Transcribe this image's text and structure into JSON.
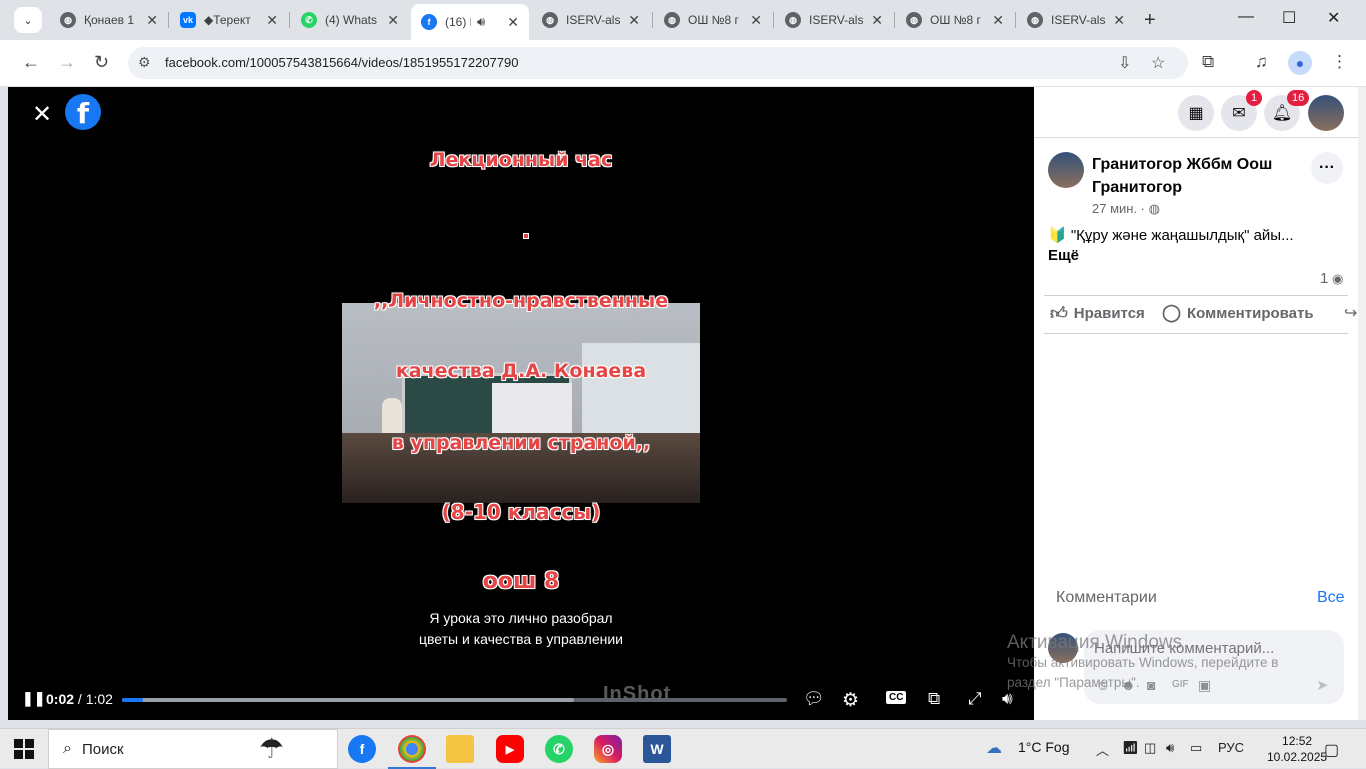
{
  "browser": {
    "tabs": [
      {
        "title": "Қонаев 1",
        "favicon": "globe-icon",
        "active": false
      },
      {
        "title": "◆Терект",
        "favicon": "vk-icon",
        "active": false
      },
      {
        "title": "(4) Whats",
        "favicon": "whatsapp-icon",
        "active": false
      },
      {
        "title": "(16) F",
        "favicon": "facebook-icon",
        "active": true,
        "audio": true
      },
      {
        "title": "ISERV-als",
        "favicon": "globe-icon",
        "active": false
      },
      {
        "title": "ОШ №8 г",
        "favicon": "globe-icon",
        "active": false
      },
      {
        "title": "ISERV-als",
        "favicon": "globe-icon",
        "active": false
      },
      {
        "title": "ОШ №8 г",
        "favicon": "globe-icon",
        "active": false
      },
      {
        "title": "ISERV-als",
        "favicon": "globe-icon",
        "active": false
      }
    ],
    "url": "facebook.com/100057543815664/videos/1851955172207790"
  },
  "video": {
    "slide_lines": [
      "Лекционный час",
      ",,Личностно-нравственные",
      "качества Д.А. Конаева",
      "в управлении страной,,",
      "(8-10 классы)",
      "оош 8"
    ],
    "caption_line1": "Я урока это лично разобрал",
    "caption_line2": "цветы и качества в управлении",
    "watermark": "InShot",
    "current_time": "0:02",
    "duration": "/ 1:02",
    "progress_played": 0.032,
    "progress_buffered": 0.68,
    "cc_label": "CC"
  },
  "header": {
    "messenger_badge": "1",
    "notifications_badge": "16"
  },
  "post": {
    "page_name": "Гранитогор Жббм Оош Гранитогор",
    "time": "27 мин. ·",
    "text": "🔰 \"Құру және жаңашылдық\" айы...",
    "more": "Ещё",
    "views": "1",
    "like_label": "Нравится",
    "comment_label": "Комментировать"
  },
  "comments": {
    "title": "Комментарии",
    "all": "Все",
    "placeholder": "Напишите комментарий..."
  },
  "windows_activation": {
    "title": "Активация Windows",
    "text_line1": "Чтобы активировать Windows, перейдите в",
    "text_line2": "раздел \"Параметры\"."
  },
  "taskbar": {
    "search": "Поиск",
    "weather": "1°C  Fog",
    "language": "РУС",
    "time": "12:52",
    "date": "10.02.2025"
  },
  "colors": {
    "facebook_blue": "#1877f2",
    "badge_red": "#e41e3f",
    "slide_text_red": "#e64545"
  }
}
